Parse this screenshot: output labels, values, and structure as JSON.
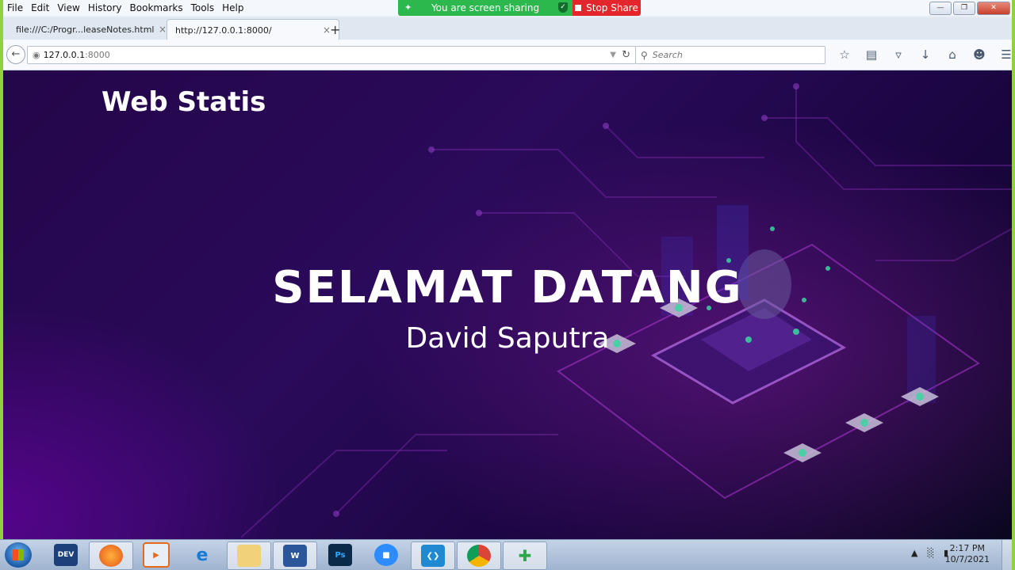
{
  "menu": [
    "File",
    "Edit",
    "View",
    "History",
    "Bookmarks",
    "Tools",
    "Help"
  ],
  "share": {
    "status": "You are screen sharing",
    "stop_label": "Stop Share"
  },
  "tabs": [
    {
      "title": "file:///C:/Progr...leaseNotes.html",
      "close": "×"
    },
    {
      "title": "http://127.0.0.1:8000/",
      "close": "×"
    }
  ],
  "newtab": "+",
  "urlbar": {
    "host": "127.0.0.1",
    "port": ":8000"
  },
  "search": {
    "placeholder": "Search"
  },
  "page": {
    "brand": "Web Statis",
    "title": "SELAMAT DATANG",
    "subtitle": "David Saputra"
  },
  "taskbar": {
    "apps": [
      {
        "name": "DEV",
        "label": "DEV\nCX"
      },
      {
        "name": "firefox"
      },
      {
        "name": "media-player"
      },
      {
        "name": "internet-explorer"
      },
      {
        "name": "file-explorer"
      },
      {
        "name": "word",
        "label": "W"
      },
      {
        "name": "photoshop",
        "label": "Ps"
      },
      {
        "name": "zoom"
      },
      {
        "name": "vscode"
      },
      {
        "name": "chrome"
      },
      {
        "name": "app-green"
      }
    ],
    "clock_time": "2:17 PM",
    "clock_date": "10/7/2021"
  },
  "colors": {
    "share_green": "#2db84d",
    "stop_red": "#e3262b",
    "hero_bg": "#24064a"
  }
}
